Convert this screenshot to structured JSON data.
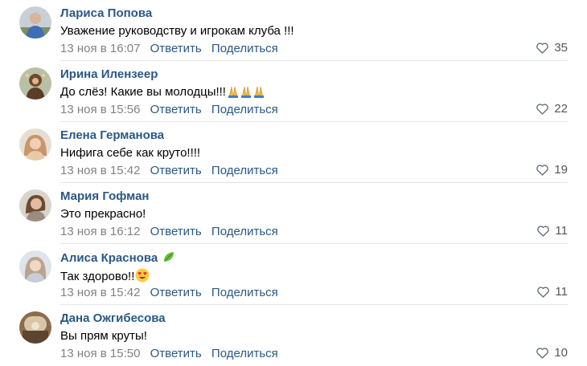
{
  "colors": {
    "name": "#2a5885",
    "link": "#2a5885",
    "time": "#828282",
    "likes": "#555555",
    "divider": "#e5e5e5"
  },
  "comments": [
    {
      "author": "Лариса Попова",
      "text": "Уважение руководству и игрокам клуба !!!",
      "time": "13 ноя в 16:07",
      "reply": "Ответить",
      "share": "Поделиться",
      "likes": "35"
    },
    {
      "author": "Ирина Илензеер",
      "text": "До слёз! Какие вы молодцы!!!",
      "time": "13 ноя в 15:56",
      "reply": "Ответить",
      "share": "Поделиться",
      "likes": "22",
      "emoji": "folded-hands-x3"
    },
    {
      "author": "Елена Германова",
      "text": "Нифига себе как круто!!!!",
      "time": "13 ноя в 15:42",
      "reply": "Ответить",
      "share": "Поделиться",
      "likes": "19"
    },
    {
      "author": "Мария Гофман",
      "text": "Это прекрасно!",
      "time": "13 ноя в 16:12",
      "reply": "Ответить",
      "share": "Поделиться",
      "likes": "11"
    },
    {
      "author": "Алиса Краснова",
      "text": "Так здорово!!",
      "time": "13 ноя в 15:42",
      "reply": "Ответить",
      "share": "Поделиться",
      "likes": "11",
      "emoji": "heart-eyes",
      "name_icon": "leaf-icon"
    },
    {
      "author": "Дана Ожгибесова",
      "text": "Вы прям круты!",
      "time": "13 ноя в 15:50",
      "reply": "Ответить",
      "share": "Поделиться",
      "likes": "10"
    }
  ]
}
